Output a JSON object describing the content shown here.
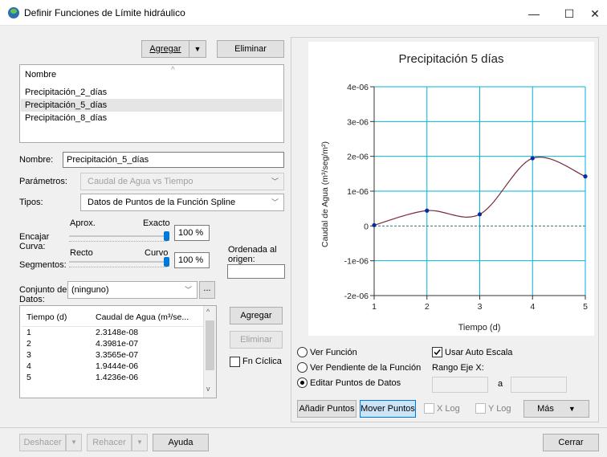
{
  "window": {
    "title": "Definir Funciones de Límite hidráulico",
    "minimize": "—",
    "maximize": "☐",
    "close": "✕"
  },
  "toolbar": {
    "add_label": "Agregar",
    "add_dropdown": "▼",
    "delete_label": "Eliminar"
  },
  "function_list": {
    "header": "Nombre",
    "items": [
      "Precipitación_2_días",
      "Precipitación_5_días",
      "Precipitación_8_días"
    ],
    "selected_index": 1
  },
  "form": {
    "name_label": "Nombre:",
    "name_value": "Precipitación_5_días",
    "params_label": "Parámetros:",
    "params_value": "Caudal de Agua vs Tiempo",
    "types_label": "Tipos:",
    "types_value": "Datos de Puntos de la Función Spline",
    "fit_label_1": "Encajar",
    "fit_label_2": "Curva:",
    "approx_label": "Aprox.",
    "exact_label": "Exacto",
    "fit_value": "100 %",
    "fit_level": 1.0,
    "straight_label": "Recto",
    "curved_label": "Curvo",
    "segments_label": "Segmentos:",
    "segments_value": "100 %",
    "segments_level": 1.0,
    "ordinate_label_1": "Ordenada al",
    "ordinate_label_2": "origen:",
    "ordinate_value": "",
    "dataset_label_1": "Conjunto de",
    "dataset_label_2": "Datos:",
    "dataset_value": "(ninguno)",
    "dataset_more": "..."
  },
  "table": {
    "columns": [
      "Tiempo (d)",
      "Caudal de Agua (m³/se..."
    ],
    "rows": [
      [
        "1",
        "2.3148e-08"
      ],
      [
        "2",
        "4.3981e-07"
      ],
      [
        "3",
        "3.3565e-07"
      ],
      [
        "4",
        "1.9444e-06"
      ],
      [
        "5",
        "1.4236e-06"
      ]
    ]
  },
  "table_actions": {
    "add": "Agregar",
    "delete": "Eliminar",
    "cyclic": "Fn Cíclica",
    "cyclic_checked": false
  },
  "view_options": {
    "show_function": "Ver Función",
    "show_slope": "Ver Pendiente de la Función",
    "edit_points": "Editar Puntos de Datos",
    "selected": "edit_points",
    "auto_scale": "Usar Auto Escala",
    "auto_scale_checked": true,
    "x_range_label": "Rango Eje X:",
    "x_range_from": "",
    "x_range_to_label": "a",
    "x_range_to": "",
    "add_points": "Añadir Puntos",
    "move_points": "Mover Puntos",
    "x_log": "X Log",
    "y_log": "Y Log",
    "more": "Más",
    "more_arrow": "▼"
  },
  "footer": {
    "undo": "Deshacer",
    "redo": "Rehacer",
    "dropdown": "▼",
    "help": "Ayuda",
    "close": "Cerrar"
  },
  "colors": {
    "accent": "#0078d7",
    "grid": "#00b4dc",
    "curve": "#7a2a3a",
    "point": "#0a2aa0",
    "zero_line": "#2d7a7a"
  },
  "chart_data": {
    "type": "line",
    "title": "Precipitación 5 días",
    "xlabel": "Tiempo (d)",
    "ylabel": "Caudal de Agua (m³/seg/m²)",
    "x_ticks": [
      "1",
      "2",
      "3",
      "4",
      "5"
    ],
    "y_ticks": [
      "4e-06",
      "3e-06",
      "2e-06",
      "1e-06",
      "0",
      "-1e-06",
      "-2e-06"
    ],
    "xlim": [
      1,
      5
    ],
    "ylim": [
      -2e-06,
      4e-06
    ],
    "grid": true,
    "x": [
      1,
      2,
      3,
      4,
      5
    ],
    "y": [
      2.3148e-08,
      4.3981e-07,
      3.3565e-07,
      1.9444e-06,
      1.4236e-06
    ]
  }
}
